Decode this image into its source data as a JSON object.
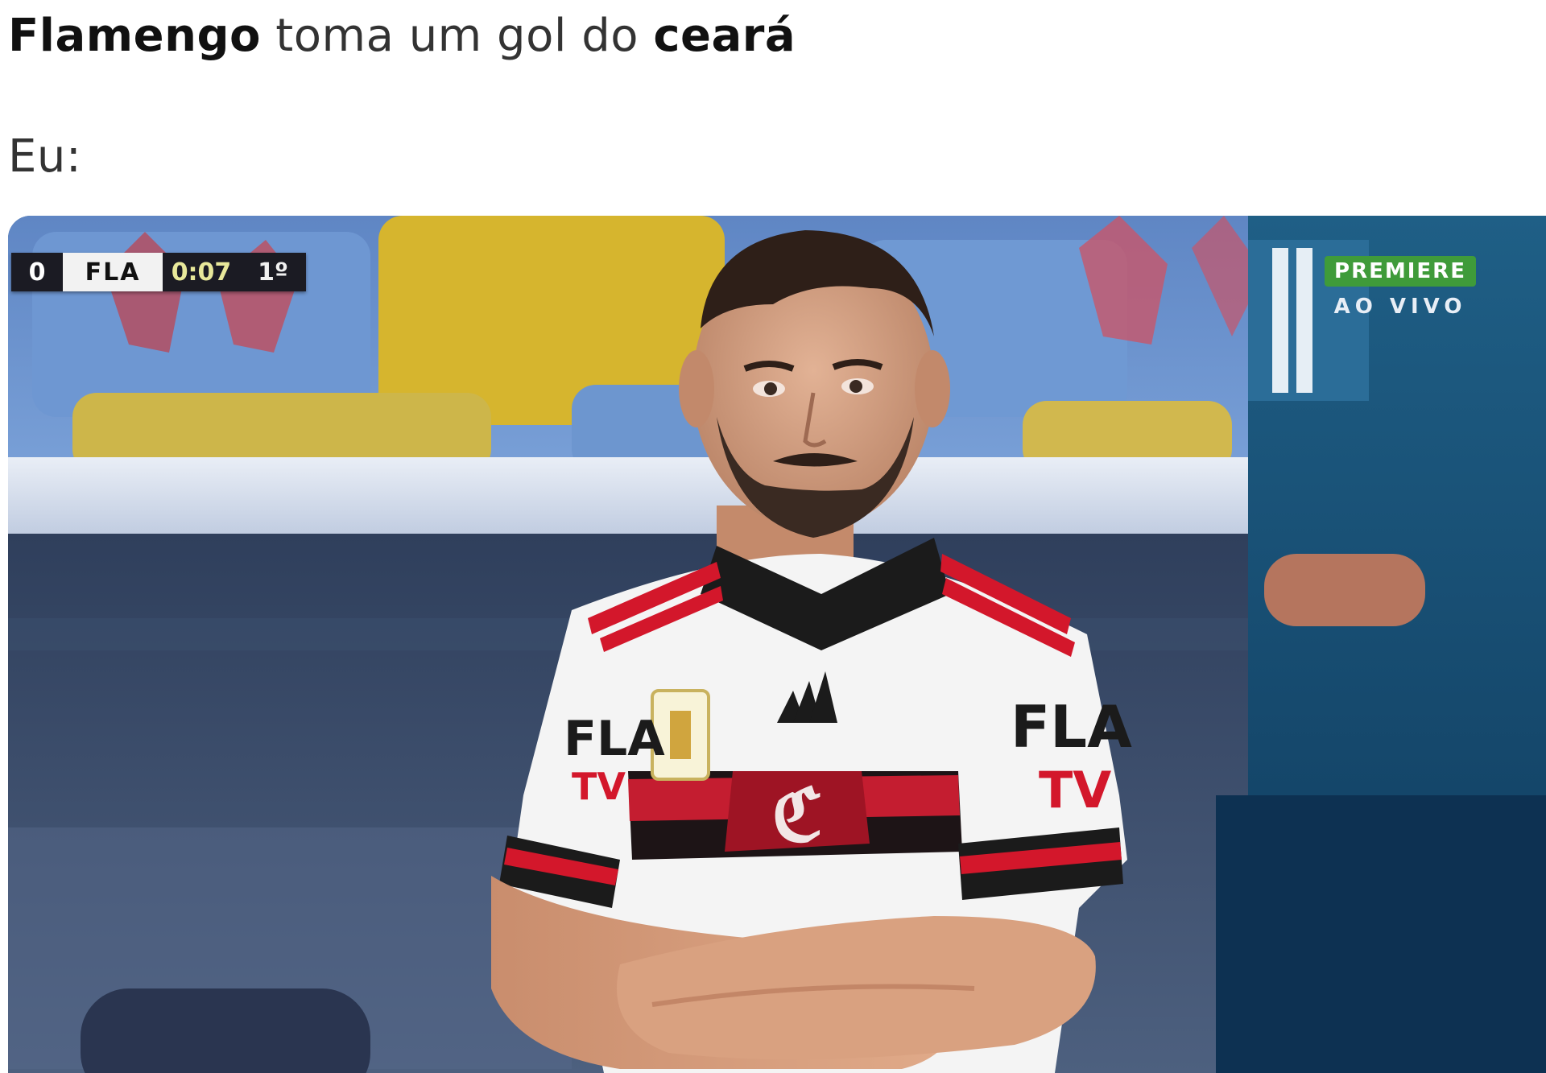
{
  "caption": {
    "line1_bold_1": "Flamengo",
    "line1_text": " toma um gol do ",
    "line1_bold_2": "ceará",
    "line2": "Eu:"
  },
  "broadcast": {
    "scorebug": {
      "score": "0",
      "team": "FLA",
      "clock": "0:07",
      "half": "1º"
    },
    "channel_badge": "PREMIERE",
    "live_label": "AO VIVO"
  },
  "jersey": {
    "sponsor_left": "FLA TV",
    "sponsor_right": "FLA TV"
  },
  "colors": {
    "flamengo_red": "#d3172b",
    "flamengo_black": "#1a1a1a",
    "premiere_green": "#3f9b3a"
  }
}
